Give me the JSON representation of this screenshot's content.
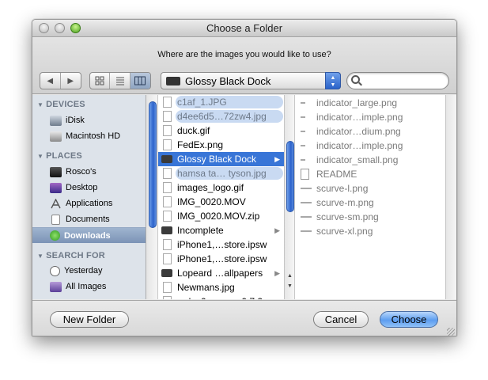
{
  "window": {
    "title": "Choose a Folder"
  },
  "prompt": "Where are the images you would like to use?",
  "nav": {
    "back_icon": "back-arrow-icon",
    "forward_icon": "forward-arrow-icon"
  },
  "view_modes": [
    "icon-view",
    "list-view",
    "column-view"
  ],
  "location": {
    "label": "Glossy Black Dock"
  },
  "search": {
    "placeholder": ""
  },
  "sidebar": {
    "sections": [
      {
        "label": "DEVICES",
        "items": [
          {
            "label": "iDisk"
          },
          {
            "label": "Macintosh HD"
          }
        ]
      },
      {
        "label": "PLACES",
        "items": [
          {
            "label": "Rosco's"
          },
          {
            "label": "Desktop"
          },
          {
            "label": "Applications"
          },
          {
            "label": "Documents"
          },
          {
            "label": "Downloads",
            "selected": true
          }
        ]
      },
      {
        "label": "SEARCH FOR",
        "items": [
          {
            "label": "Yesterday"
          },
          {
            "label": "All Images"
          }
        ]
      }
    ]
  },
  "column1": [
    {
      "label": "c1af_1.JPG",
      "style": "pill"
    },
    {
      "label": "d4ee6d5…72zw4.jpg",
      "style": "pill"
    },
    {
      "label": "duck.gif",
      "style": "normal"
    },
    {
      "label": "FedEx.png",
      "style": "normal"
    },
    {
      "label": "Glossy Black Dock",
      "style": "selected",
      "folder": true
    },
    {
      "label": "hamsa ta… tyson.jpg",
      "style": "pill"
    },
    {
      "label": "images_logo.gif",
      "style": "normal"
    },
    {
      "label": "IMG_0020.MOV",
      "style": "normal"
    },
    {
      "label": "IMG_0020.MOV.zip",
      "style": "normal"
    },
    {
      "label": "Incomplete",
      "style": "normal",
      "folder": true
    },
    {
      "label": "iPhone1,…store.ipsw",
      "style": "normal"
    },
    {
      "label": "iPhone1,…store.ipsw",
      "style": "normal"
    },
    {
      "label": "Lopeard …allpapers",
      "style": "normal",
      "folder": true
    },
    {
      "label": "Newmans.jpg",
      "style": "normal"
    },
    {
      "label": "redsn0w_mac_0.7.2",
      "style": "normal"
    }
  ],
  "column2": [
    {
      "label": "indicator_large.png"
    },
    {
      "label": "indicator…imple.png"
    },
    {
      "label": "indicator…dium.png"
    },
    {
      "label": "indicator…imple.png"
    },
    {
      "label": "indicator_small.png"
    },
    {
      "label": "README"
    },
    {
      "label": "scurve-l.png"
    },
    {
      "label": "scurve-m.png"
    },
    {
      "label": "scurve-sm.png"
    },
    {
      "label": "scurve-xl.png"
    }
  ],
  "buttons": {
    "new_folder": "New Folder",
    "cancel": "Cancel",
    "choose": "Choose"
  }
}
